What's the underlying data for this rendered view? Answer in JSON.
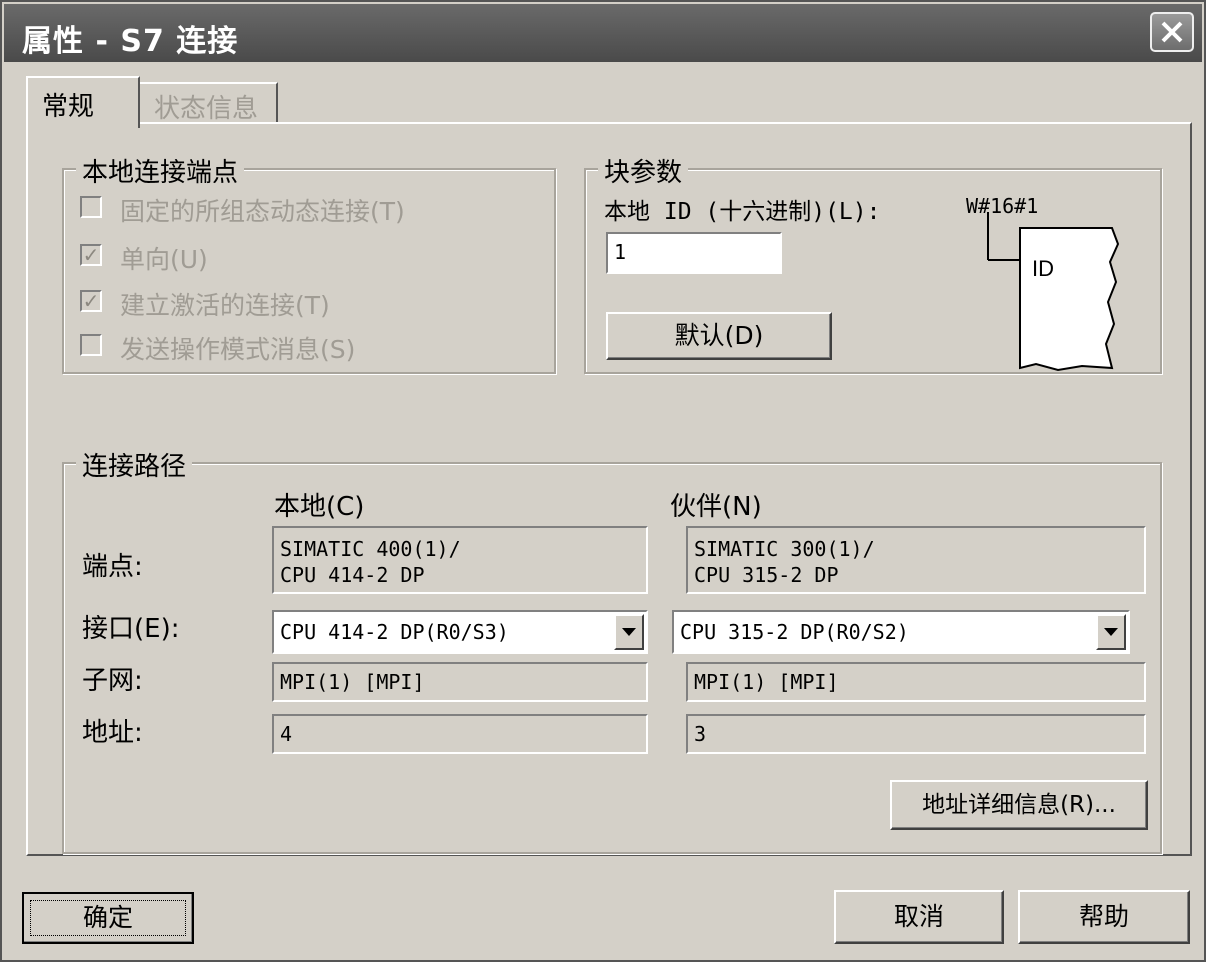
{
  "window": {
    "title": "属性 - S7 连接"
  },
  "tabs": [
    {
      "label": "常规",
      "active": true
    },
    {
      "label": "状态信息",
      "active": false
    }
  ],
  "local_endpoint": {
    "title": "本地连接端点",
    "options": [
      {
        "label": "固定的所组态动态连接(T)",
        "checked": false
      },
      {
        "label": "单向(U)",
        "checked": true
      },
      {
        "label": "建立激活的连接(T)",
        "checked": true
      },
      {
        "label": "发送操作模式消息(S)",
        "checked": false
      }
    ]
  },
  "block_params": {
    "title": "块参数",
    "local_id_label": "本地 ID (十六进制)(L):",
    "local_id_value": "1",
    "hex_display": "W#16#1",
    "diagram_label": "ID",
    "default_button": "默认(D)"
  },
  "connection_path": {
    "title": "连接路径",
    "local_header": "本地(C)",
    "partner_header": "伙伴(N)",
    "rows": {
      "endpoint_label": "端点:",
      "interface_label": "接口(E):",
      "subnet_label": "子网:",
      "address_label": "地址:"
    },
    "local": {
      "endpoint_line1": "SIMATIC 400(1)/",
      "endpoint_line2": "CPU 414-2 DP",
      "interface": "CPU 414-2 DP(R0/S3)",
      "subnet": "MPI(1) [MPI]",
      "address": "4"
    },
    "partner": {
      "endpoint_line1": "SIMATIC 300(1)/",
      "endpoint_line2": "CPU 315-2 DP",
      "interface": "CPU 315-2 DP(R0/S2)",
      "subnet": "MPI(1) [MPI]",
      "address": "3"
    },
    "address_details_button": "地址详细信息(R)..."
  },
  "footer": {
    "ok": "确定",
    "cancel": "取消",
    "help": "帮助"
  },
  "icons": {
    "close": "close-icon",
    "dropdown": "chevron-down-icon"
  }
}
